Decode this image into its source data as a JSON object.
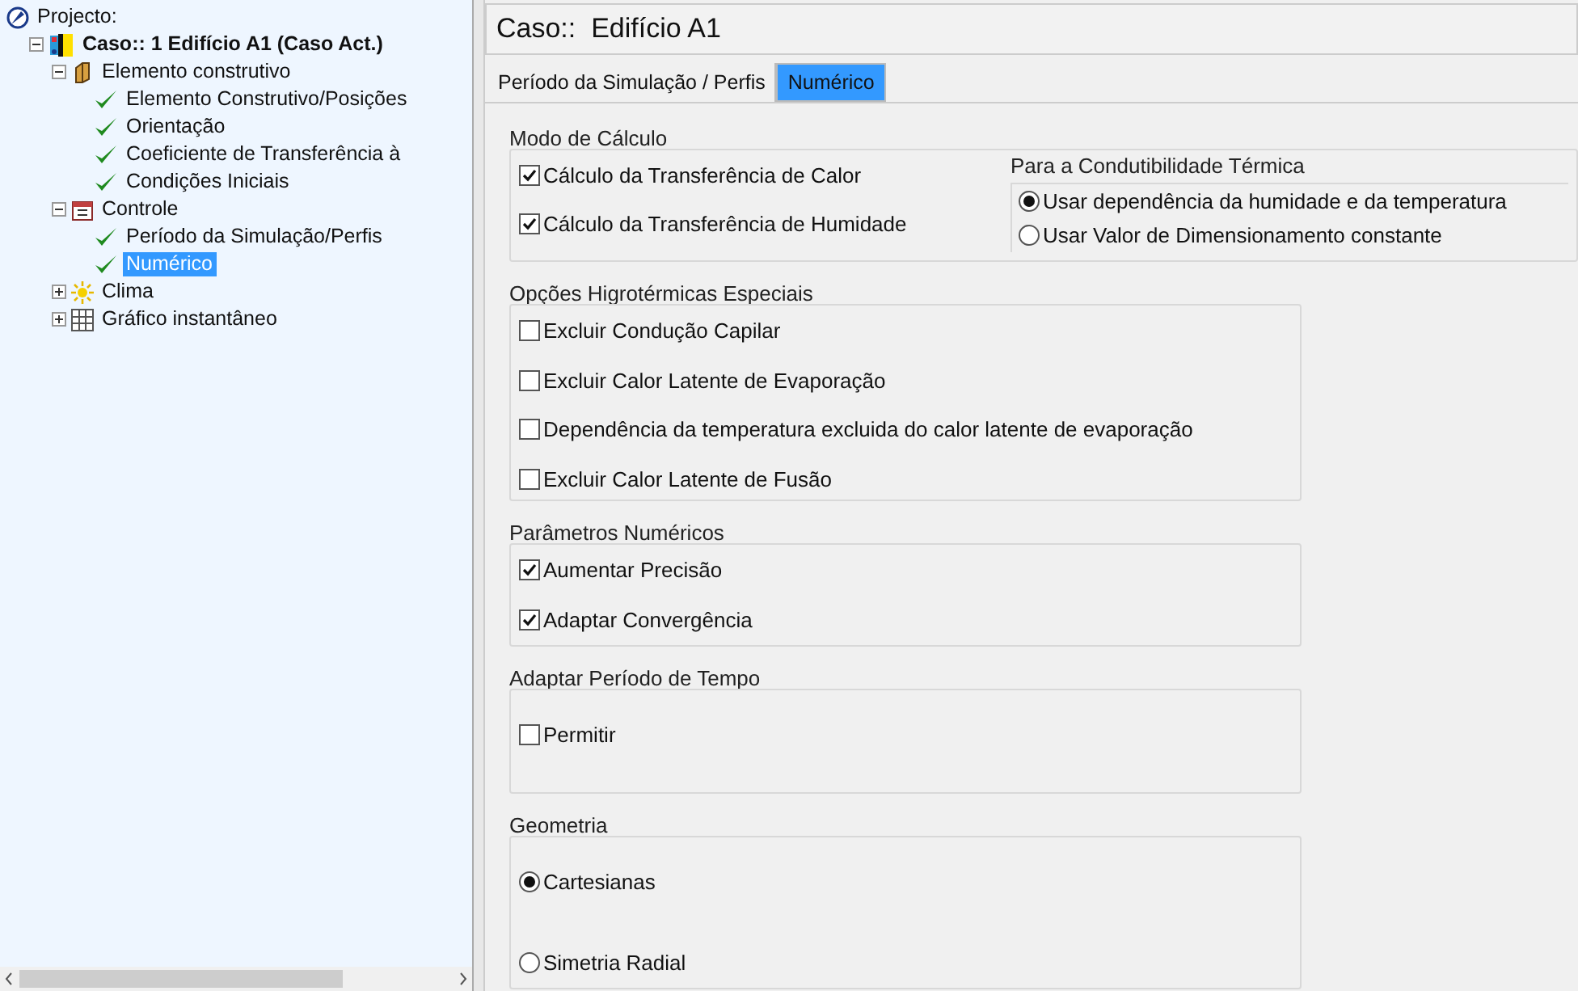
{
  "tree": {
    "label": "Projecto:",
    "kind": "project",
    "selected": false,
    "children": [
      {
        "label": "Caso:: 1 Edifício A1 (Caso Act.)",
        "kind": "case",
        "expanded": true,
        "selected": false,
        "children": [
          {
            "label": "Elemento construtivo",
            "kind": "element",
            "expanded": true,
            "selected": false,
            "children": [
              {
                "label": "Elemento Construtivo/Posições",
                "kind": "check",
                "selected": false
              },
              {
                "label": "Orientação",
                "kind": "check",
                "selected": false
              },
              {
                "label": "Coeficiente de Transferência à",
                "kind": "check",
                "selected": false
              },
              {
                "label": "Condições Iniciais",
                "kind": "check",
                "selected": false
              }
            ]
          },
          {
            "label": "Controle",
            "kind": "control",
            "expanded": true,
            "selected": false,
            "children": [
              {
                "label": "Período da Simulação/Perfis",
                "kind": "check",
                "selected": false
              },
              {
                "label": "Numérico",
                "kind": "check",
                "selected": true
              }
            ]
          },
          {
            "label": "Clima",
            "kind": "sun",
            "expanded": false,
            "selected": false
          },
          {
            "label": "Gráfico instantâneo",
            "kind": "grid",
            "expanded": false,
            "selected": false
          }
        ]
      }
    ]
  },
  "header": {
    "title": "Caso::  Edifício A1"
  },
  "tabs": [
    {
      "label": "Período da Simulação / Perfis",
      "selected": false
    },
    {
      "label": "Numérico",
      "selected": true
    }
  ],
  "groups": [
    {
      "title": "Modo de Cálculo",
      "options": [
        {
          "kind": "checkbox",
          "label": "Cálculo da Transferência de Calor",
          "checked": true
        },
        {
          "kind": "checkbox",
          "label": "Cálculo da Transferência de Humidade",
          "checked": true
        }
      ],
      "subgroup": {
        "title": "Para a Condutibilidade Térmica",
        "options": [
          {
            "kind": "radio",
            "label": "Usar dependência da humidade e da temperatura",
            "selected": true
          },
          {
            "kind": "radio",
            "label": "Usar Valor de Dimensionamento constante",
            "selected": false
          }
        ]
      }
    },
    {
      "title": "Opções Higrotérmicas Especiais",
      "options": [
        {
          "kind": "checkbox",
          "label": "Excluir Condução Capilar",
          "checked": false
        },
        {
          "kind": "checkbox",
          "label": "Excluir Calor Latente de Evaporação",
          "checked": false
        },
        {
          "kind": "checkbox",
          "label": "Dependência da temperatura excluida do calor latente de evaporação",
          "checked": false
        },
        {
          "kind": "checkbox",
          "label": "Excluir Calor Latente de Fusão",
          "checked": false
        }
      ]
    },
    {
      "title": "Parâmetros Numéricos",
      "options": [
        {
          "kind": "checkbox",
          "label": "Aumentar Precisão",
          "checked": true
        },
        {
          "kind": "checkbox",
          "label": "Adaptar Convergência",
          "checked": true
        }
      ]
    },
    {
      "title": "Adaptar Período de Tempo",
      "options": [
        {
          "kind": "checkbox",
          "label": "Permitir",
          "checked": false
        }
      ]
    },
    {
      "title": "Geometria",
      "options": [
        {
          "kind": "radio",
          "label": "Cartesianas",
          "selected": true
        },
        {
          "kind": "radio",
          "label": "Simetria Radial",
          "selected": false
        }
      ]
    }
  ]
}
